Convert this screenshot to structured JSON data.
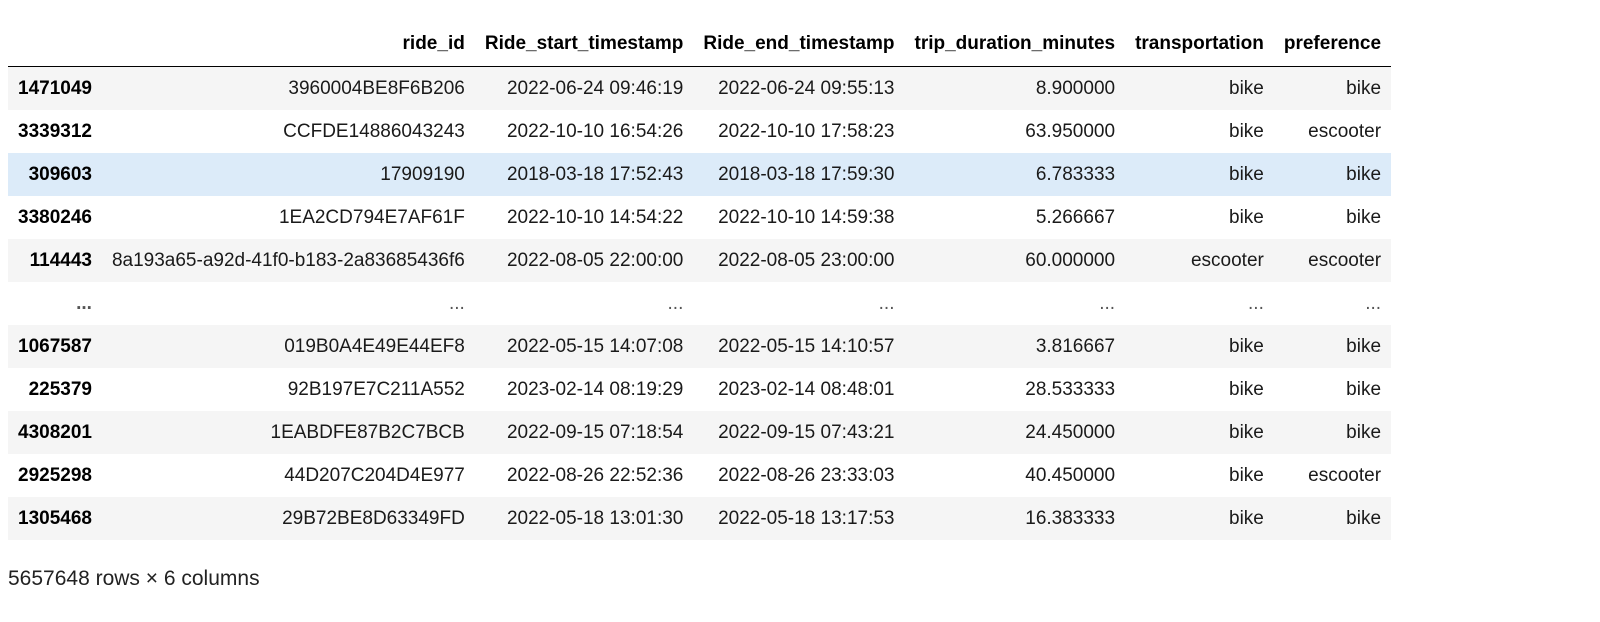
{
  "table": {
    "index_header": "",
    "columns": [
      "ride_id",
      "Ride_start_timestamp",
      "Ride_end_timestamp",
      "trip_duration_minutes",
      "transportation",
      "preference"
    ],
    "hovered_row": 2,
    "rows": [
      {
        "index": "1471049",
        "cells": [
          "3960004BE8F6B206",
          "2022-06-24 09:46:19",
          "2022-06-24 09:55:13",
          "8.900000",
          "bike",
          "bike"
        ]
      },
      {
        "index": "3339312",
        "cells": [
          "CCFDE14886043243",
          "2022-10-10 16:54:26",
          "2022-10-10 17:58:23",
          "63.950000",
          "bike",
          "escooter"
        ]
      },
      {
        "index": "309603",
        "cells": [
          "17909190",
          "2018-03-18 17:52:43",
          "2018-03-18 17:59:30",
          "6.783333",
          "bike",
          "bike"
        ]
      },
      {
        "index": "3380246",
        "cells": [
          "1EA2CD794E7AF61F",
          "2022-10-10 14:54:22",
          "2022-10-10 14:59:38",
          "5.266667",
          "bike",
          "bike"
        ]
      },
      {
        "index": "114443",
        "cells": [
          "8a193a65-a92d-41f0-b183-2a83685436f6",
          "2022-08-05 22:00:00",
          "2022-08-05 23:00:00",
          "60.000000",
          "escooter",
          "escooter"
        ]
      },
      {
        "index": "...",
        "cells": [
          "...",
          "...",
          "...",
          "...",
          "...",
          "..."
        ]
      },
      {
        "index": "1067587",
        "cells": [
          "019B0A4E49E44EF8",
          "2022-05-15 14:07:08",
          "2022-05-15 14:10:57",
          "3.816667",
          "bike",
          "bike"
        ]
      },
      {
        "index": "225379",
        "cells": [
          "92B197E7C211A552",
          "2023-02-14 08:19:29",
          "2023-02-14 08:48:01",
          "28.533333",
          "bike",
          "bike"
        ]
      },
      {
        "index": "4308201",
        "cells": [
          "1EABDFE87B2C7BCB",
          "2022-09-15 07:18:54",
          "2022-09-15 07:43:21",
          "24.450000",
          "bike",
          "bike"
        ]
      },
      {
        "index": "2925298",
        "cells": [
          "44D207C204D4E977",
          "2022-08-26 22:52:36",
          "2022-08-26 23:33:03",
          "40.450000",
          "bike",
          "escooter"
        ]
      },
      {
        "index": "1305468",
        "cells": [
          "29B72BE8D63349FD",
          "2022-05-18 13:01:30",
          "2022-05-18 13:17:53",
          "16.383333",
          "bike",
          "bike"
        ]
      }
    ]
  },
  "footer": {
    "shape_text": "5657648 rows × 6 columns"
  },
  "colors": {
    "row_stripe": "#f5f5f5",
    "row_hover": "#dcebf9",
    "header_rule": "#000000"
  }
}
